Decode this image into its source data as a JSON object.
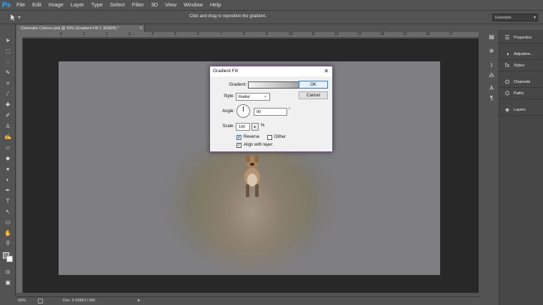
{
  "app": {
    "logo": "Ps"
  },
  "menubar": {
    "items": [
      "File",
      "Edit",
      "Image",
      "Layer",
      "Type",
      "Select",
      "Filter",
      "3D",
      "View",
      "Window",
      "Help"
    ]
  },
  "options": {
    "hint": "Click and drag to reposition the gradient.",
    "workspace": "Essentials"
  },
  "document": {
    "tab_title": "Cinematic Colours.psd @ 50% (Gradient Fill 1, RGB/8) *",
    "ruler_marks": [
      "0",
      "1",
      "2",
      "3",
      "4",
      "5",
      "6",
      "7",
      "8",
      "9",
      "10",
      "11",
      "12",
      "13",
      "14",
      "15",
      "16",
      "17"
    ]
  },
  "status": {
    "zoom": "50%",
    "doc_size": "Doc: 5.93M/17.8M"
  },
  "panels": {
    "items": [
      {
        "label": "Properties",
        "icon": "properties-icon"
      },
      {
        "label": "Adjustme...",
        "icon": "adjustments-icon"
      },
      {
        "label": "Styles",
        "icon": "styles-icon"
      },
      {
        "label": "Channels",
        "icon": "channels-icon"
      },
      {
        "label": "Paths",
        "icon": "paths-icon"
      },
      {
        "label": "Layers",
        "icon": "layers-icon"
      }
    ]
  },
  "dialog": {
    "title": "Gradient Fill",
    "gradient_label": "Gradient:",
    "style_label": "Style:",
    "style_value": "Radial",
    "angle_label": "Angle:",
    "angle_value": "90",
    "angle_unit": "°",
    "scale_label": "Scale:",
    "scale_value": "100",
    "scale_unit": "%",
    "reverse_label": "Reverse",
    "reverse_checked": true,
    "dither_label": "Dither",
    "dither_checked": false,
    "align_label": "Align with layer",
    "align_checked": true,
    "ok_label": "OK",
    "cancel_label": "Cancel"
  }
}
